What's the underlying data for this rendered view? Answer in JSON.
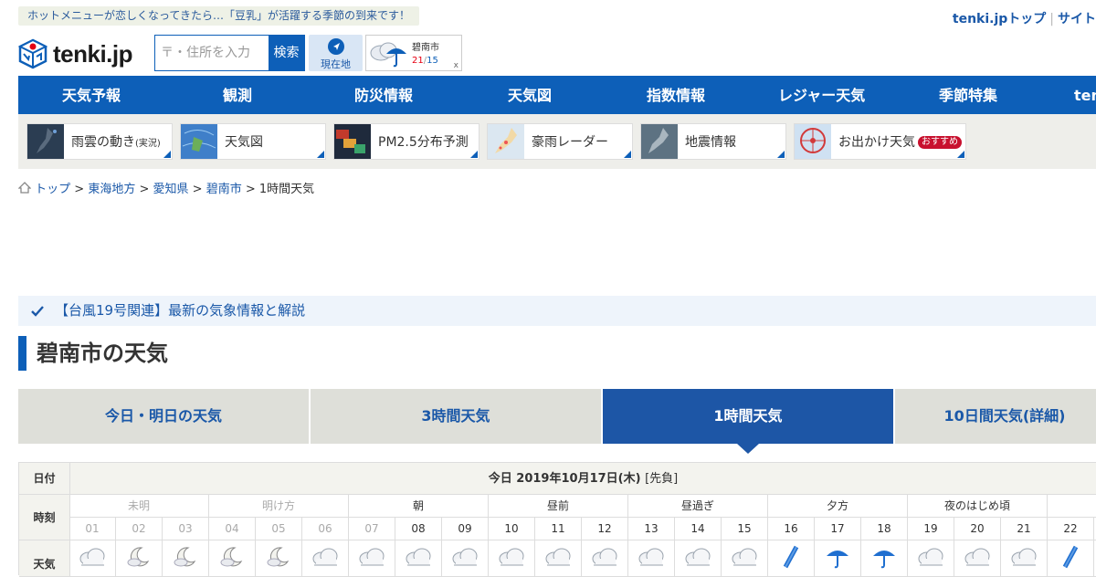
{
  "notice": "ホットメニューが恋しくなってきたら…「豆乳」が活躍する季節の到来です！",
  "top_links": [
    "tenki.jpトップ",
    "サイト"
  ],
  "logo_text": "tenki.jp",
  "search": {
    "placeholder": "〒・住所を入力",
    "button": "検索"
  },
  "current_location": "現在地",
  "mini_card": {
    "city": "碧南市",
    "high": "21",
    "low": "15",
    "close": "x"
  },
  "nav": [
    "天気予報",
    "観測",
    "防災情報",
    "天気図",
    "指数情報",
    "レジャー天気",
    "季節特集",
    "ten"
  ],
  "sub_tiles": [
    {
      "label": "雨雲の動き",
      "small": "(実況)"
    },
    {
      "label": "天気図",
      "small": ""
    },
    {
      "label": "PM2.5分布予測",
      "small": ""
    },
    {
      "label": "豪雨レーダー",
      "small": ""
    },
    {
      "label": "地震情報",
      "small": ""
    },
    {
      "label": "お出かけ天気",
      "small": "",
      "badge": "おすすめ"
    }
  ],
  "breadcrumb": [
    "トップ",
    "東海地方",
    "愛知県",
    "碧南市",
    "1時間天気"
  ],
  "banner": "【台風19号関連】最新の気象情報と解説",
  "page_title": "碧南市の天気",
  "tabs": [
    "今日・明日の天気",
    "3時間天気",
    "1時間天気",
    "10日間天気(詳細)"
  ],
  "active_tab": 2,
  "table": {
    "date_label": "日付",
    "date_value": "今日 2019年10月17日(木)",
    "rokuyo": "[先負]",
    "time_label": "時刻",
    "weather_label": "天気",
    "periods": [
      {
        "name": "未明",
        "muted": true
      },
      {
        "name": "明け方",
        "muted": true
      },
      {
        "name": "朝",
        "muted": false
      },
      {
        "name": "昼前",
        "muted": false
      },
      {
        "name": "昼過ぎ",
        "muted": false
      },
      {
        "name": "夕方",
        "muted": false
      },
      {
        "name": "夜のはじめ頃",
        "muted": false
      }
    ],
    "hours": [
      "01",
      "02",
      "03",
      "04",
      "05",
      "06",
      "07",
      "08",
      "09",
      "10",
      "11",
      "12",
      "13",
      "14",
      "15",
      "16",
      "17",
      "18",
      "19",
      "20",
      "21",
      "22"
    ],
    "weather": [
      "cloud",
      "moon",
      "moon",
      "moon",
      "moon",
      "cloud",
      "cloud",
      "cloud",
      "cloud",
      "cloud",
      "cloud",
      "cloud",
      "cloud",
      "cloud",
      "cloud",
      "light-rain",
      "umbrella",
      "umbrella",
      "cloud",
      "cloud",
      "cloud",
      "light-rain"
    ]
  },
  "colors": {
    "brand": "#0d5fb8",
    "tab_active": "#1d56a6",
    "high": "#e60012",
    "low": "#0d5fb8"
  }
}
